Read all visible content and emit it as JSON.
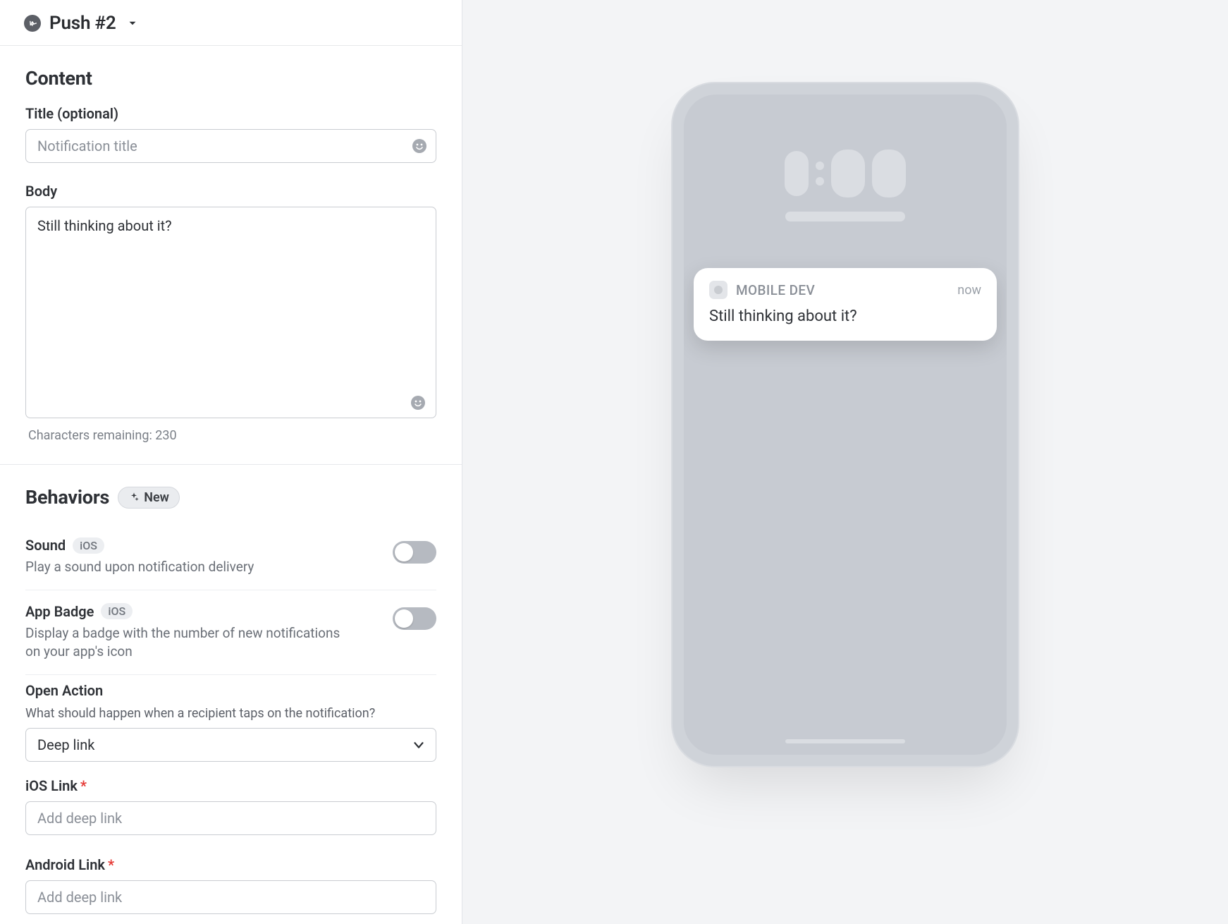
{
  "header": {
    "title": "Push #2"
  },
  "content": {
    "section_title": "Content",
    "title_label": "Title (optional)",
    "title_placeholder": "Notification title",
    "body_label": "Body",
    "body_value": "Still thinking about it?",
    "chars_remaining": "Characters remaining: 230"
  },
  "behaviors": {
    "section_title": "Behaviors",
    "new_badge": "New",
    "sound": {
      "title": "Sound",
      "platform": "iOS",
      "desc": "Play a sound upon notification delivery"
    },
    "appbadge": {
      "title": "App Badge",
      "platform": "iOS",
      "desc": "Display a badge with the number of new notifications on your app's icon"
    },
    "open_action": {
      "title": "Open Action",
      "help": "What should happen when a recipient taps on the notification?",
      "selected": "Deep link"
    },
    "ios_link": {
      "label": "iOS Link",
      "placeholder": "Add deep link"
    },
    "android_link": {
      "label": "Android Link",
      "placeholder": "Add deep link"
    }
  },
  "preview": {
    "app_name": "MOBILE DEV",
    "time": "now",
    "body": "Still thinking about it?"
  }
}
